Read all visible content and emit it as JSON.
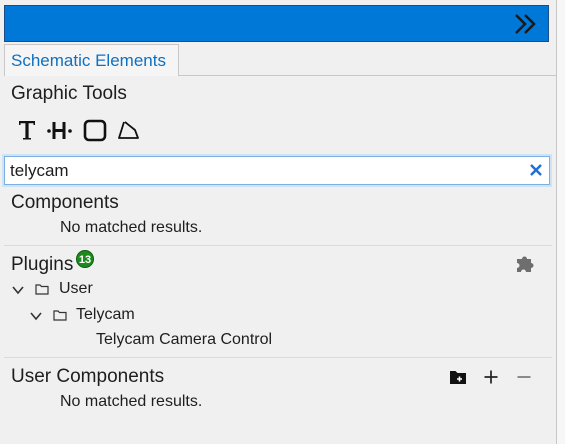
{
  "tabs": [
    {
      "label": "Schematic Elements"
    }
  ],
  "graphic_tools": {
    "title": "Graphic Tools",
    "tools": [
      {
        "icon": "text-tool-icon"
      },
      {
        "icon": "wire-tool-icon"
      },
      {
        "icon": "rectangle-tool-icon"
      },
      {
        "icon": "polygon-tool-icon"
      }
    ]
  },
  "search": {
    "value": "telycam",
    "clear_icon": "close-icon"
  },
  "components": {
    "title": "Components",
    "empty_message": "No matched results."
  },
  "plugins": {
    "title": "Plugins",
    "badge": "13",
    "tree": [
      {
        "label": "User"
      },
      {
        "label": "Telycam"
      },
      {
        "label": "Telycam Camera Control"
      }
    ]
  },
  "user_components": {
    "title": "User Components",
    "empty_message": "No matched results."
  },
  "colors": {
    "titlebar": "#0078d7",
    "badge": "#1c8a1c",
    "tab_text": "#1070c0",
    "clear_icon": "#1f6fd6"
  }
}
